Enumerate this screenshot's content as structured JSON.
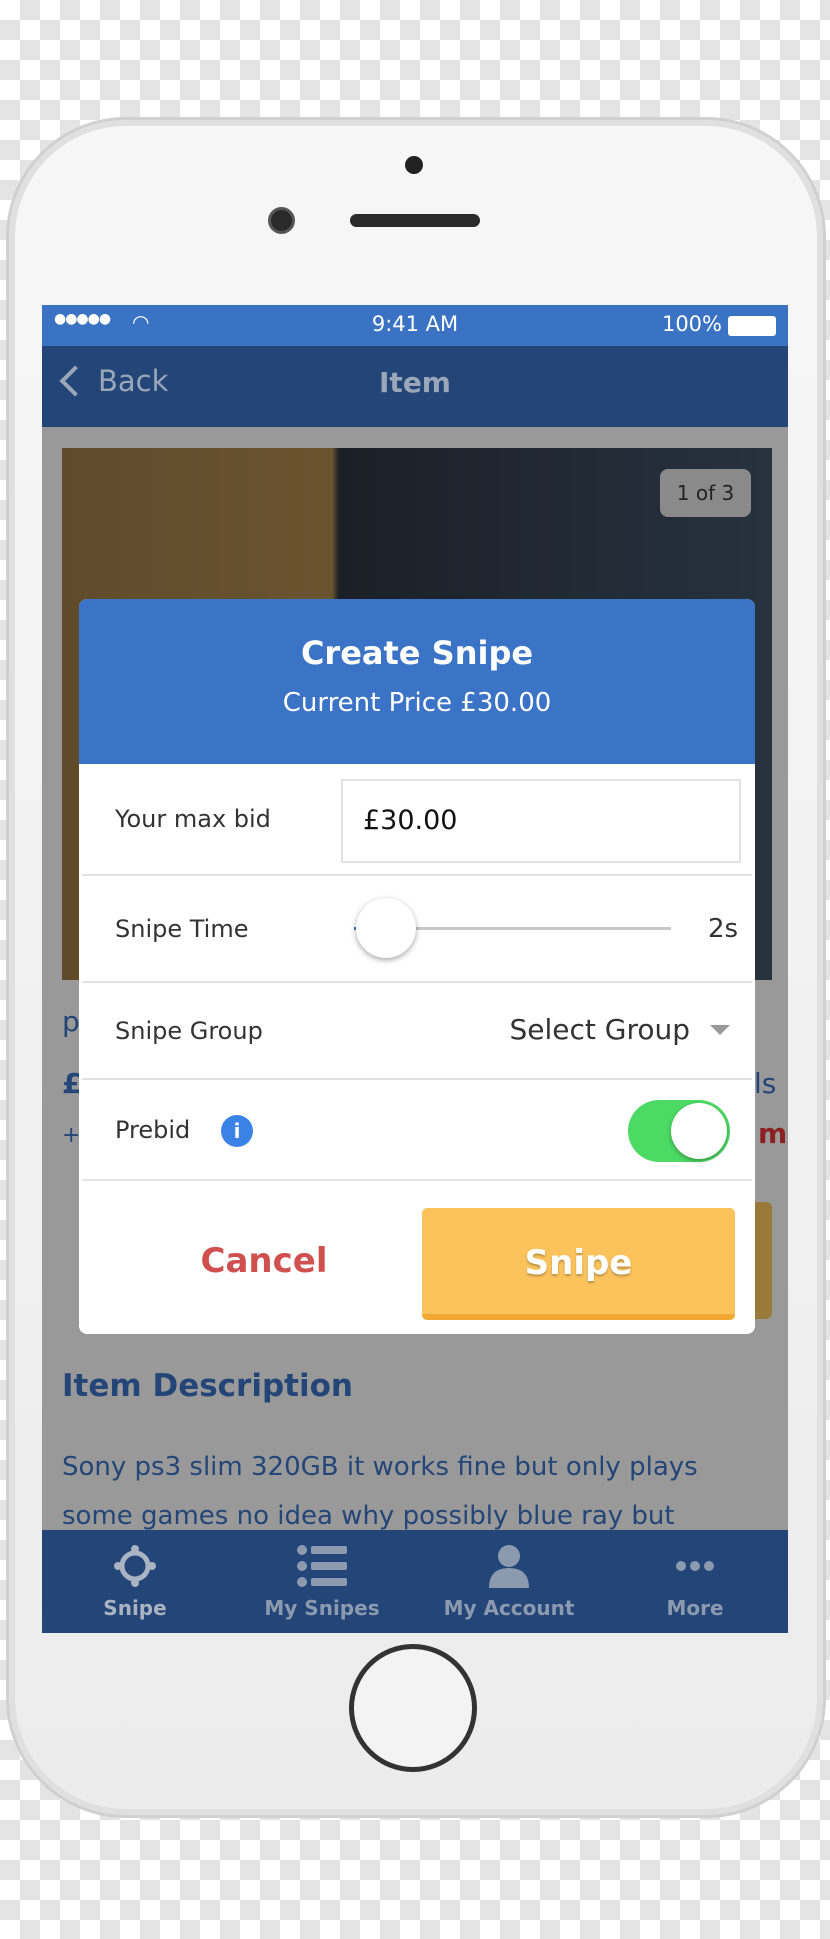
{
  "status_bar": {
    "time": "9:41 AM",
    "battery": "100%"
  },
  "nav": {
    "back_label": "Back",
    "title": "Item"
  },
  "gallery": {
    "counter": "1 of 3"
  },
  "background": {
    "fragments": [
      "p",
      "£",
      "+",
      "ls",
      "m"
    ],
    "section_title": "Item Description",
    "description": "Sony ps3 slim 320GB it works fine but only plays some games no idea why possibly blue ray but"
  },
  "dialog": {
    "title": "Create Snipe",
    "subtitle": "Current Price £30.00",
    "max_bid_label": "Your max bid",
    "max_bid_value": "£30.00",
    "snipe_time_label": "Snipe Time",
    "snipe_time_value": "2s",
    "snipe_time_fraction": 0.1,
    "group_label": "Snipe Group",
    "group_value": "Select Group",
    "prebid_label": "Prebid",
    "prebid_on": true,
    "cancel_label": "Cancel",
    "snipe_label": "Snipe"
  },
  "tabs": [
    {
      "label": "Snipe",
      "icon": "crosshair-icon",
      "active": true
    },
    {
      "label": "My Snipes",
      "icon": "list-icon"
    },
    {
      "label": "My Account",
      "icon": "user-icon"
    },
    {
      "label": "More",
      "icon": "more-icon"
    }
  ],
  "colors": {
    "primary": "#3b74c6",
    "nav": "#234577",
    "cancel": "#d0504f",
    "snipe": "#fcc35c",
    "toggle": "#4cd964",
    "info": "#3b82e6"
  }
}
